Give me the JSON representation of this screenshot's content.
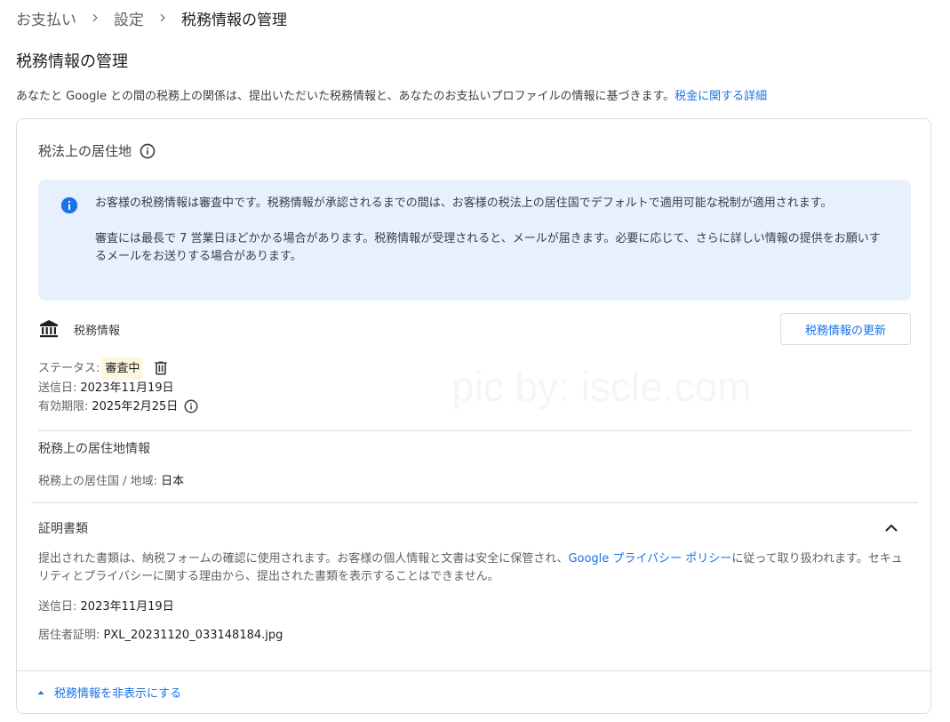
{
  "breadcrumb": {
    "items": [
      "お支払い",
      "設定"
    ],
    "current": "税務情報の管理"
  },
  "page": {
    "title": "税務情報の管理",
    "intro": "あなたと Google との間の税務上の関係は、提出いただいた税務情報と、あなたのお支払いプロファイルの情報に基づきます。",
    "intro_link": "税金に関する詳細"
  },
  "residency": {
    "title": "税法上の居住地",
    "notice": {
      "line1": "お客様の税務情報は審査中です。税務情報が承認されるまでの間は、お客様の税法上の居住国でデフォルトで適用可能な税制が適用されます。",
      "line2": "審査には最長で 7 営業日ほどかかる場合があります。税務情報が受理されると、メールが届きます。必要に応じて、さらに詳しい情報の提供をお願いするメールをお送りする場合があります。"
    }
  },
  "tax_info": {
    "label": "税務情報",
    "update_button": "税務情報の更新",
    "status_label": "ステータス:",
    "status_value": "審査中",
    "sent_label": "送信日:",
    "sent_value": "2023年11月19日",
    "expiry_label": "有効期限:",
    "expiry_value": "2025年2月25日"
  },
  "residence_info": {
    "title": "税務上の居住地情報",
    "country_label": "税務上の居住国 / 地域:",
    "country_value": "日本"
  },
  "documents": {
    "title": "証明書類",
    "desc_before": "提出された書類は、納税フォームの確認に使用されます。お客様の個人情報と文書は安全に保管され、",
    "desc_link": "Google プライバシー ポリシー",
    "desc_after": "に従って取り扱われます。セキュリティとプライバシーに関する理由から、提出された書類を表示することはできません。",
    "sent_label": "送信日:",
    "sent_value": "2023年11月19日",
    "file_label": "居住者証明:",
    "file_value": "PXL_20231120_033148184.jpg"
  },
  "toggle": {
    "label": "税務情報を非表示にする"
  },
  "watermark": "pic by: iscle.com",
  "colors": {
    "link": "#1a73e8",
    "notice_bg": "#e8f0fe",
    "badge_bg": "#fef7e0"
  }
}
